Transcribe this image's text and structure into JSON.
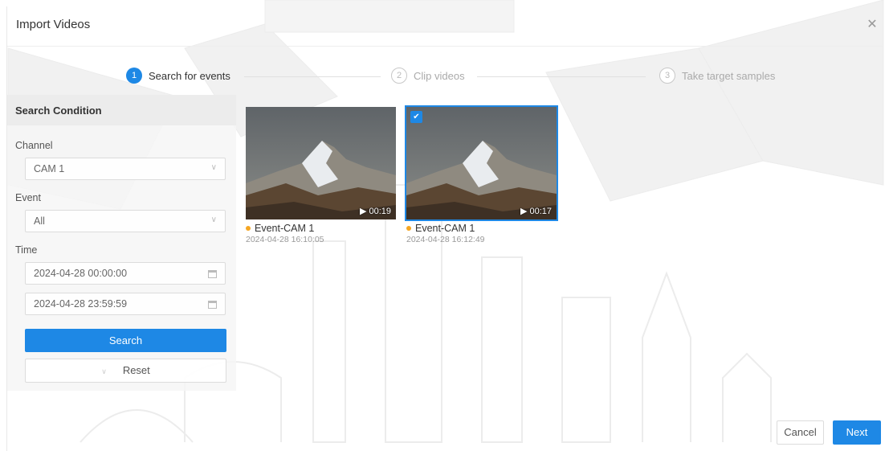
{
  "dialog": {
    "title": "Import Videos",
    "close_icon": "close-icon"
  },
  "steps": [
    {
      "number": "1",
      "label": "Search for events",
      "state": "active"
    },
    {
      "number": "2",
      "label": "Clip videos",
      "state": "inactive"
    },
    {
      "number": "3",
      "label": "Take target samples",
      "state": "inactive"
    }
  ],
  "search_condition": {
    "header": "Search Condition",
    "channel_label": "Channel",
    "channel_value": "CAM 1",
    "event_label": "Event",
    "event_value": "All",
    "time_label": "Time",
    "start_time": "2024-04-28 00:00:00",
    "end_time": "2024-04-28 23:59:59",
    "search_label": "Search",
    "reset_label": "Reset"
  },
  "videos": [
    {
      "name": "Event-CAM 1",
      "timestamp": "2024-04-28 16:10:05",
      "duration": "00:19",
      "selected": false
    },
    {
      "name": "Event-CAM 1",
      "timestamp": "2024-04-28 16:12:49",
      "duration": "00:17",
      "selected": true
    }
  ],
  "footer": {
    "cancel_label": "Cancel",
    "next_label": "Next"
  },
  "colors": {
    "accent": "#1e88e5",
    "event_dot": "#f5a623"
  }
}
